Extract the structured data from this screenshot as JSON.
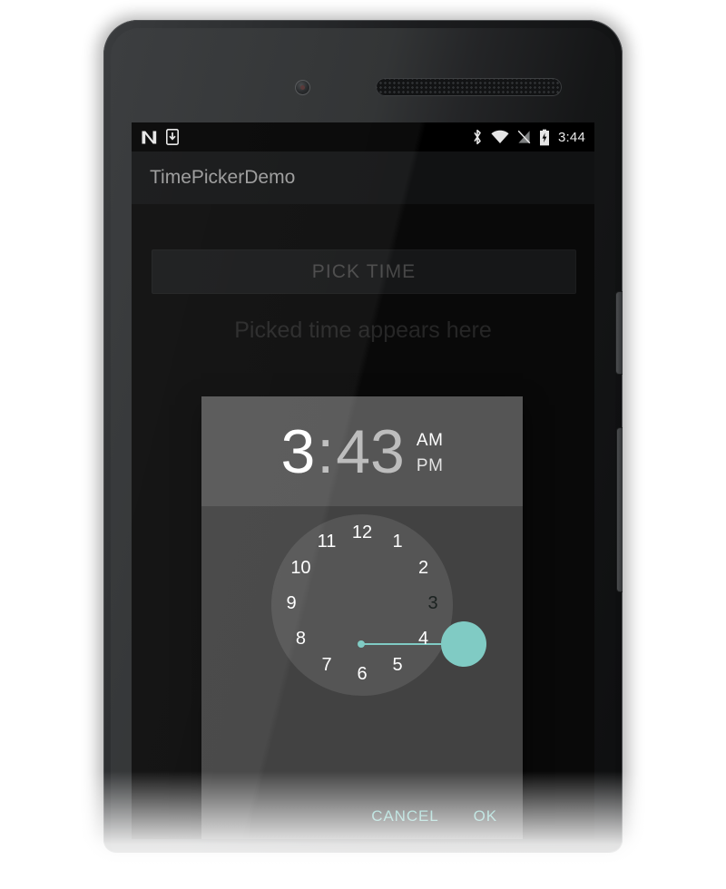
{
  "status_bar": {
    "time": "3:44",
    "icons_left": [
      "android-n-logo-icon",
      "download-indicator-icon"
    ],
    "icons_right": [
      "bluetooth-icon",
      "wifi-icon",
      "no-sim-signal-icon",
      "battery-charging-icon"
    ]
  },
  "app_bar": {
    "title": "TimePickerDemo"
  },
  "main": {
    "pick_time_button": "PICK TIME",
    "result_text": "Picked time appears here"
  },
  "dialog": {
    "hour": "3",
    "colon": ":",
    "minute": "43",
    "am_label": "AM",
    "pm_label": "PM",
    "selected_hour": "3",
    "clock_numbers": [
      "12",
      "1",
      "2",
      "3",
      "4",
      "5",
      "6",
      "7",
      "8",
      "9",
      "10",
      "11"
    ],
    "cancel_label": "CANCEL",
    "ok_label": "OK"
  },
  "colors": {
    "accent_teal": "#80CBC4",
    "dialog_body": "#424242",
    "dialog_header": "#555555",
    "clock_face": "#555555",
    "app_background": "#0E0E0F",
    "status_bar": "#000000"
  }
}
